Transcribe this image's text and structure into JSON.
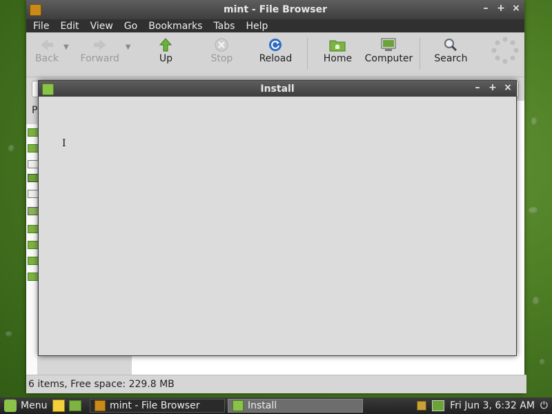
{
  "file_browser": {
    "title": "mint - File Browser",
    "menu": [
      "File",
      "Edit",
      "View",
      "Go",
      "Bookmarks",
      "Tabs",
      "Help"
    ],
    "toolbar": {
      "back": "Back",
      "forward": "Forward",
      "up": "Up",
      "stop": "Stop",
      "reload": "Reload",
      "home": "Home",
      "computer": "Computer",
      "search": "Search"
    },
    "sidebar_header": "P",
    "status": "6 items, Free space: 229.8 MB"
  },
  "install_dialog": {
    "title": "Install"
  },
  "window_controls": {
    "minimize": "–",
    "maximize": "+",
    "close": "×"
  },
  "taskbar": {
    "menu_label": "Menu",
    "tasks": [
      "mint - File Browser",
      "Install"
    ],
    "clock": "Fri Jun  3,  6:32 AM"
  },
  "colors": {
    "accent_green": "#8bc34a",
    "titlebar": "#4a4a4a",
    "menubar": "#303030",
    "desktop": "#4d7d24"
  }
}
